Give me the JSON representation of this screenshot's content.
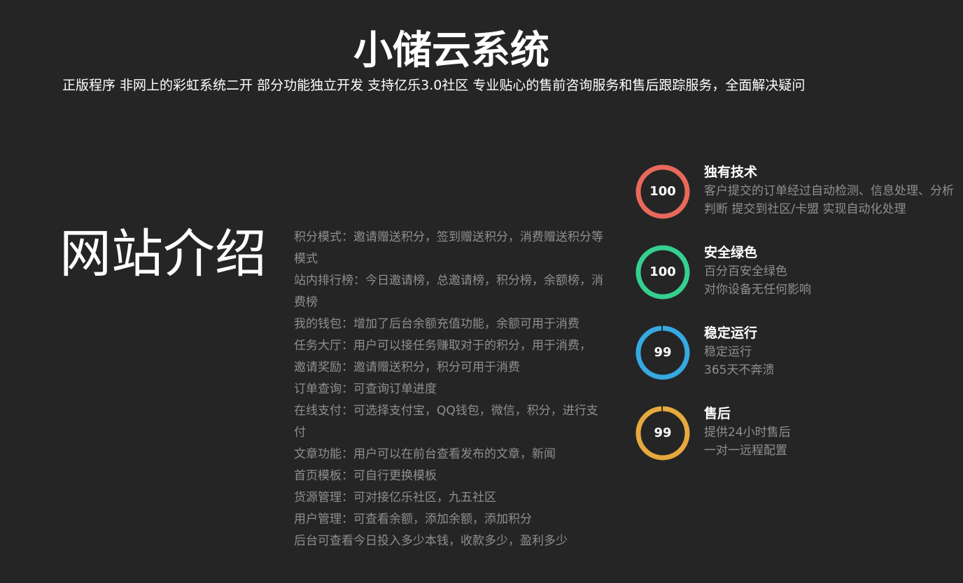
{
  "header": {
    "title": "小储云系统",
    "subtitle": "正版程序 非网上的彩虹系统二开 部分功能独立开发 支持亿乐3.0社区 专业贴心的售前咨询服务和售后跟踪服务，全面解决疑问"
  },
  "intro": {
    "heading": "网站介绍",
    "features": [
      "积分模式：邀请赠送积分，签到赠送积分，消费赠送积分等模式",
      "站内排行榜：今日邀请榜，总邀请榜，积分榜，余额榜，消费榜",
      "我的钱包：增加了后台余额充值功能，余额可用于消费",
      "任务大厅：用户可以接任务赚取对于的积分，用于消费，",
      "邀请奖励：邀请赠送积分，积分可用于消费",
      "订单查询：可查询订单进度",
      "在线支付：可选择支付宝，QQ钱包，微信，积分，进行支付",
      "文章功能：用户可以在前台查看发布的文章，新闻",
      "首页模板：可自行更换模板",
      "货源管理：可对接亿乐社区，九五社区",
      "用户管理：可查看余额，添加余额，添加积分",
      "后台可查看今日投入多少本钱，收款多少，盈利多少"
    ]
  },
  "stats": [
    {
      "value": "100",
      "percent": 100,
      "color": "#e8695b",
      "title": "独有技术",
      "lines": [
        "客户提交的订单经过自动检测、信息处理、分析判断 提交到社区/卡盟 实现自动化处理"
      ]
    },
    {
      "value": "100",
      "percent": 100,
      "color": "#35d08f",
      "title": "安全绿色",
      "lines": [
        "百分百安全绿色",
        "对你设备无任何影响"
      ]
    },
    {
      "value": "99",
      "percent": 99,
      "color": "#36a9e1",
      "title": "稳定运行",
      "lines": [
        "稳定运行",
        "365天不奔溃"
      ]
    },
    {
      "value": "99",
      "percent": 99,
      "color": "#e6a93e",
      "title": "售后",
      "lines": [
        "提供24小时售后",
        "一对一远程配置"
      ]
    }
  ]
}
